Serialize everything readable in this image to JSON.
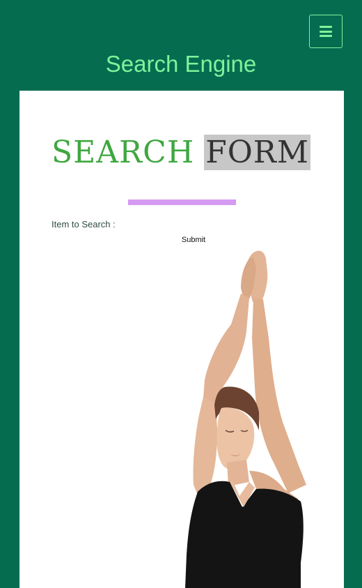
{
  "header": {
    "site_title": "Search Engine",
    "menu_icon": "hamburger-menu-icon"
  },
  "form": {
    "heading_part1": "SEARCH",
    "heading_part2": "FORM",
    "field_label": "Item to Search :",
    "submit_label": "Submit"
  },
  "colors": {
    "page_background": "#066c50",
    "title_green": "#7ef39a",
    "heading_green": "#3fa740",
    "heading_highlight": "#c7c7c7",
    "divider_purple": "#d59af2"
  }
}
